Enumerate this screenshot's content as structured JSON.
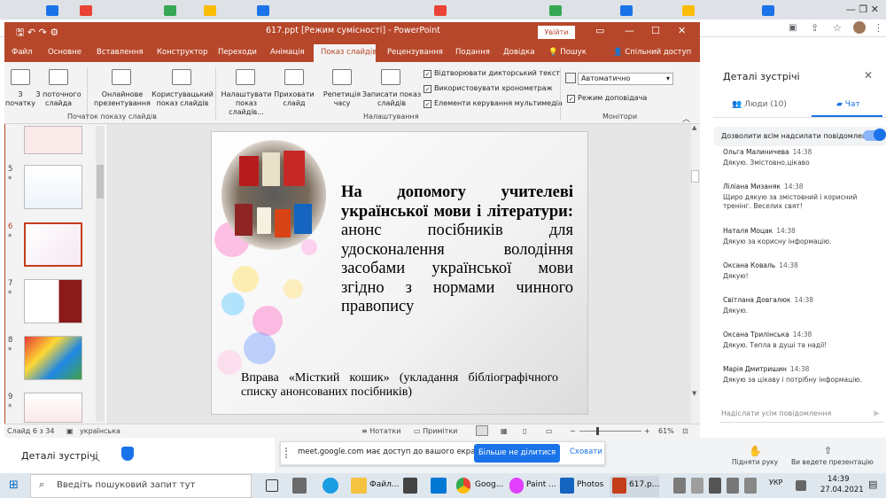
{
  "browser": {
    "controls": "—   ❐   ✕"
  },
  "meet": {
    "panel_title": "Деталі зустрічі",
    "tabs": [
      {
        "label": "Люди (10)"
      },
      {
        "label": "Чат"
      }
    ],
    "allow_messages": "Дозволити всім надсилати повідомлення",
    "messages": [
      {
        "author": "Ольга Малиничева",
        "time": "14:38",
        "text": "Дякую. Змістовно,цікаво"
      },
      {
        "author": "Ліліана Мизаняк",
        "time": "14:38",
        "text": "Щиро дякую за змістовний і корисний тренінг. Веселих свят!"
      },
      {
        "author": "Наталя Моцак",
        "time": "14:38",
        "text": "Дякую за корисну інформацію."
      },
      {
        "author": "Оксана Коваль",
        "time": "14:38",
        "text": "Дякую!"
      },
      {
        "author": "Світлана Довгалюк",
        "time": "14:38",
        "text": "Дякую."
      },
      {
        "author": "Оксана Трилінська",
        "time": "14:38",
        "text": "Дякую. Тепла в душі та надії!"
      },
      {
        "author": "Марія Дмитришин",
        "time": "14:38",
        "text": "Дякую за цікаву і потрібну інформацію."
      }
    ],
    "input_placeholder": "Надіслати усім повідомлення",
    "raise_hand": "Підняти руку",
    "presenting": "Ви ведете презентацію",
    "details_bar": "Деталі зустрічі"
  },
  "share": {
    "text": "meet.google.com має доступ до вашого екрана.",
    "stop": "Більше не ділитися",
    "hide": "Сховати"
  },
  "ppt": {
    "title": "617.ppt [Режим сумісності]  -  PowerPoint",
    "login": "Увійти",
    "ribbon_tabs": [
      "Файл",
      "Основне",
      "Вставлення",
      "Конструктор",
      "Переходи",
      "Анімація",
      "Показ слайдів",
      "Рецензування",
      "Подання",
      "Довідка"
    ],
    "search": "Пошук",
    "share": "Спільний доступ",
    "ribbon": {
      "from_start": "З\nпочатку",
      "from_current": "З поточного\nслайда",
      "online": "Онлайнове\nпрезентування",
      "custom": "Користувацький\nпоказ слайдів",
      "setup": "Налаштувати\nпоказ слайдів...",
      "hide": "Приховати\nслайд",
      "rehearse": "Репетиція\nчасу",
      "record": "Записати показ\nслайдів",
      "chk_narration": "Відтворювати дикторський текст",
      "chk_timings": "Використовувати хронометраж",
      "chk_media": "Елементи керування мультимедіа",
      "monitor": "Автоматично",
      "presenter_view": "Режим доповідача",
      "group_start": "Початок показу слайдів",
      "group_setup": "Налаштування",
      "group_monitors": "Монітори"
    },
    "thumb_numbers": [
      "5",
      "6",
      "7",
      "8",
      "9"
    ],
    "slide": {
      "title_bold": "На допомогу учителеві української мови і літератури:",
      "title_rest": "анонс посібників для удосконалення володіння засобами української мови згідно з нормами чинного правопису",
      "exercise": "Вправа «Місткий кошик» (укладання бібліографічного списку анонсованих посібників)"
    },
    "status": {
      "slide_counter": "Слайд 6 з 34",
      "language": "українська",
      "notes": "Нотатки",
      "comments": "Примітки",
      "zoom": "61%"
    }
  },
  "taskbar": {
    "search": "Введіть пошуковий запит тут",
    "apps": [
      "Файл...",
      "Goog...",
      "Paint ...",
      "Photos",
      "617.p..."
    ],
    "lang": "УКР",
    "time": "14:39",
    "date": "27.04.2021"
  }
}
